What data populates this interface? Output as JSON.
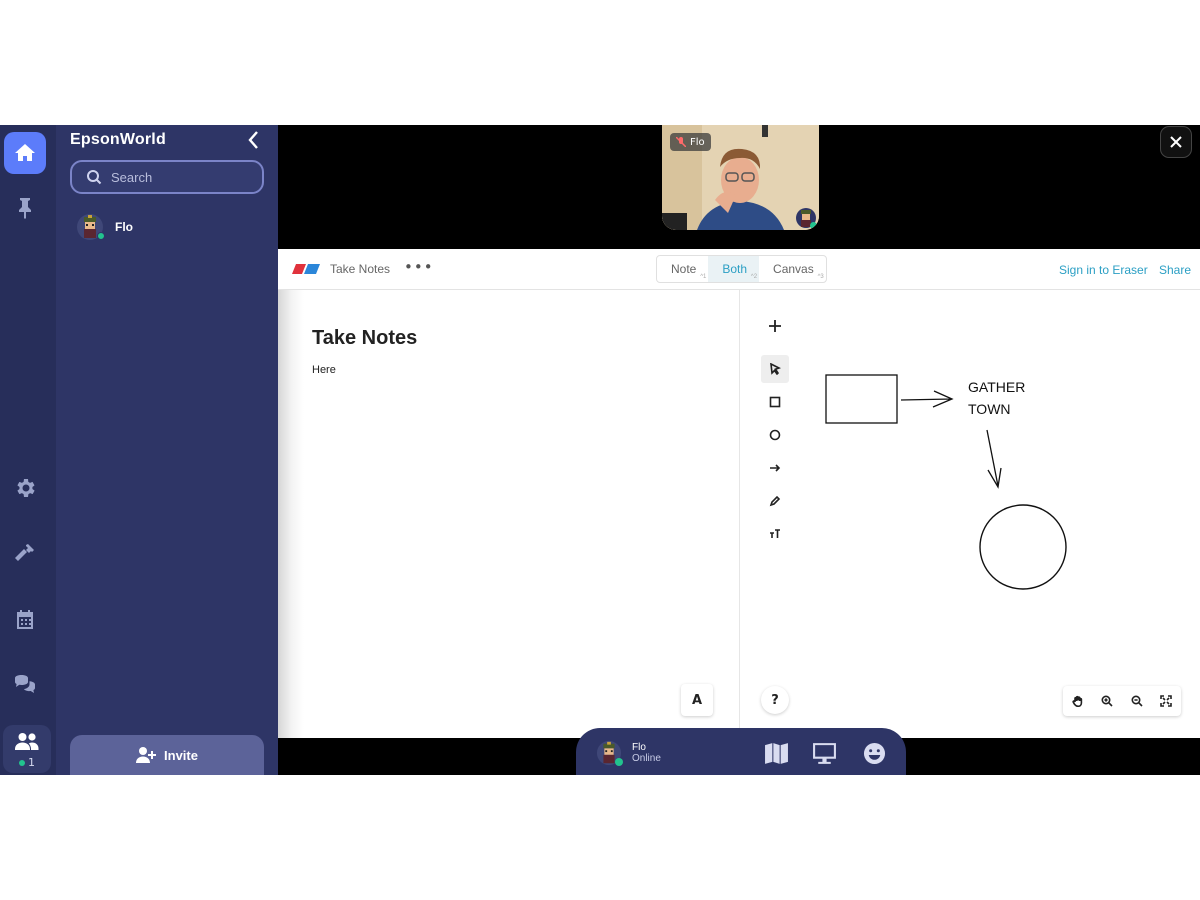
{
  "sidebar": {
    "space_name": "EpsonWorld",
    "search_placeholder": "Search",
    "members": [
      {
        "name": "Flo",
        "status": "online"
      }
    ],
    "invite_label": "Invite"
  },
  "rail": {
    "items": [
      "home-icon",
      "pin-icon",
      "settings-icon",
      "hammer-icon",
      "calendar-icon",
      "chat-icon",
      "people-icon"
    ],
    "people_count": "1"
  },
  "video": {
    "participant": "Flo",
    "muted": true
  },
  "eraser": {
    "doc_name": "Take Notes",
    "more": "•••",
    "modes": [
      {
        "label": "Note",
        "shortcut": "^1"
      },
      {
        "label": "Both",
        "shortcut": "^2",
        "active": true
      },
      {
        "label": "Canvas",
        "shortcut": "^3"
      }
    ],
    "sign_in": "Sign in to Eraser",
    "share": "Share",
    "note_title": "Take Notes",
    "note_body": "Here",
    "font_button": "A",
    "help_button": "?",
    "canvas_text_line1": "GATHER",
    "canvas_text_line2": "TOWN",
    "tools": [
      "plus-icon",
      "select-icon",
      "rectangle-icon",
      "circle-icon",
      "arrow-icon",
      "pen-icon",
      "text-icon"
    ],
    "zoom_tools": [
      "hand-icon",
      "zoom-in-icon",
      "zoom-out-icon",
      "fit-icon"
    ]
  },
  "bottom_bar": {
    "name": "Flo",
    "status": "Online",
    "actions": [
      "map-icon",
      "screen-share-icon",
      "emoji-icon"
    ]
  },
  "colors": {
    "rail_bg": "#272e5a",
    "sidebar_bg": "#2e3566",
    "accent": "#5c7cfa",
    "online": "#22c38e",
    "eraser_link": "#2b9fc4"
  }
}
